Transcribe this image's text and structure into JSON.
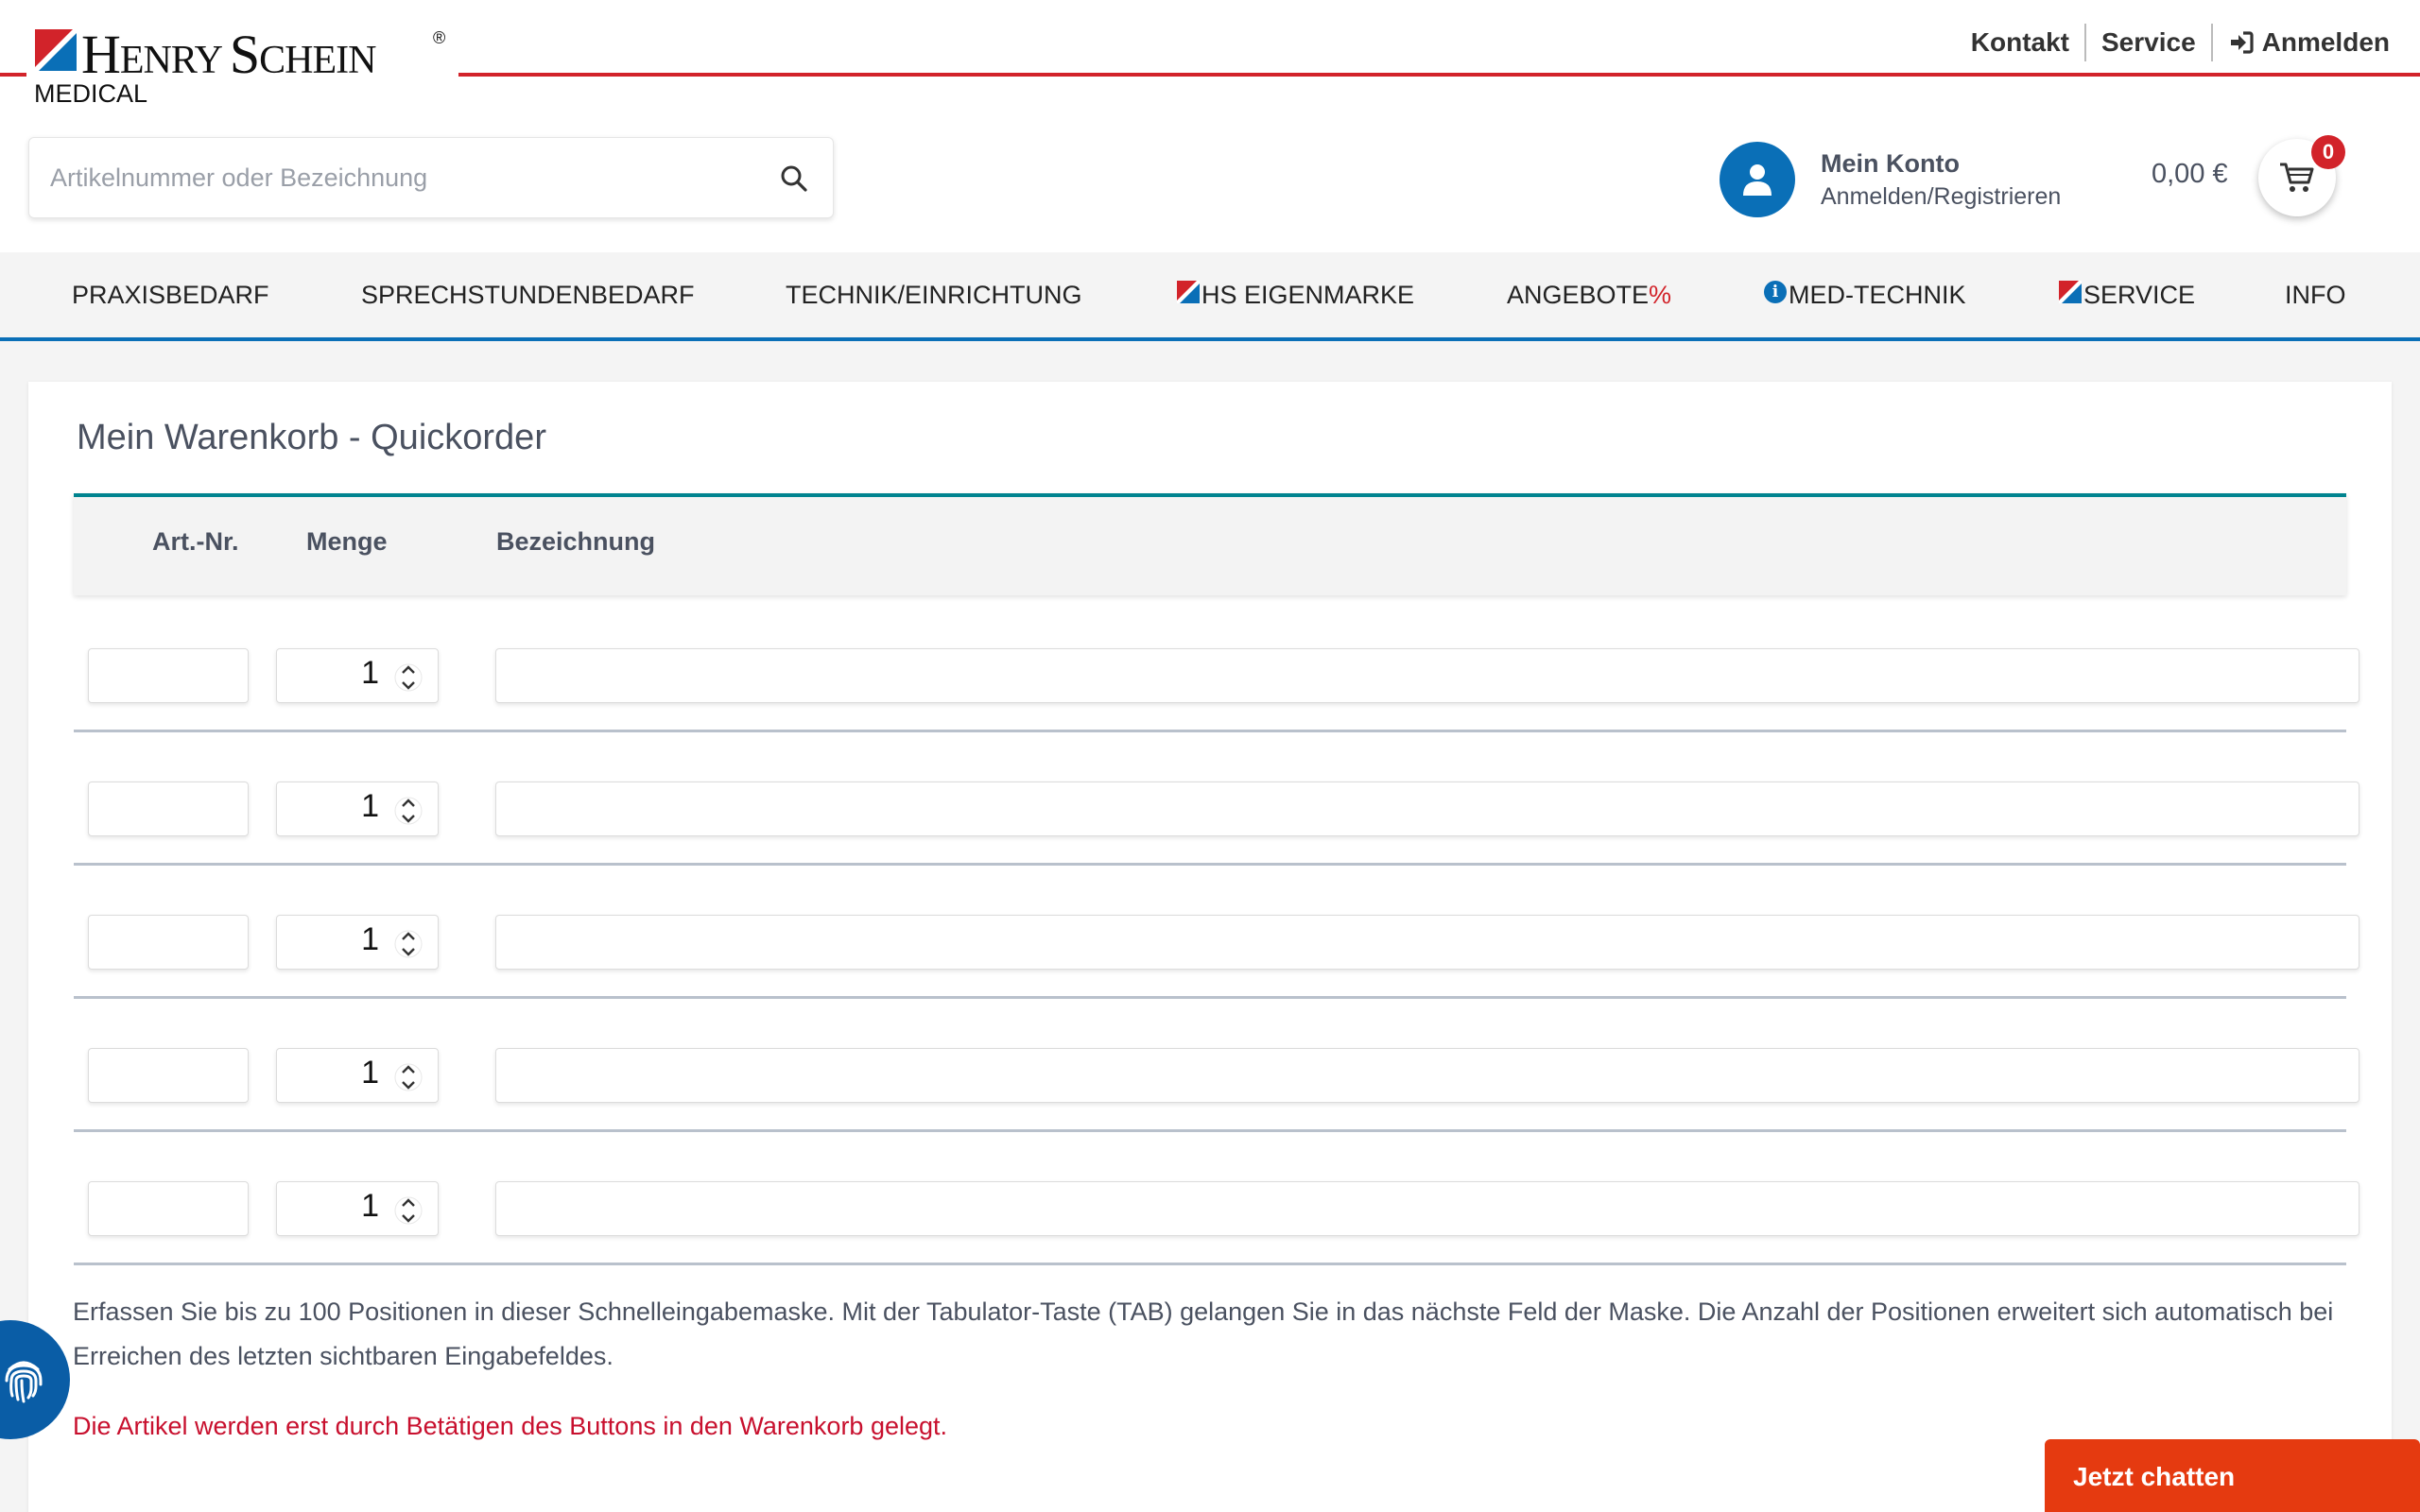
{
  "brand": {
    "name_first": "H",
    "name_first_small": "ENRY ",
    "name_second": "S",
    "name_second_small": "CHEIN",
    "registered": "®",
    "sub": "MEDICAL"
  },
  "toplinks": {
    "contact": "Kontakt",
    "service": "Service",
    "login": "Anmelden"
  },
  "search": {
    "placeholder": "Artikelnummer oder Bezeichnung"
  },
  "account": {
    "title": "Mein Konto",
    "subtitle": "Anmelden/Registrieren"
  },
  "cart": {
    "total": "0,00 €",
    "count": "0"
  },
  "nav": {
    "items": [
      {
        "label": "PRAXISBEDARF"
      },
      {
        "label": "SPRECHSTUNDENBEDARF"
      },
      {
        "label": "TECHNIK/EINRICHTUNG"
      },
      {
        "label": "HS EIGENMARKE"
      },
      {
        "label": "ANGEBOTE",
        "suffix": "%"
      },
      {
        "label": "MED-TECHNIK"
      },
      {
        "label": "SERVICE"
      },
      {
        "label": "INFO"
      }
    ]
  },
  "quickorder": {
    "title": "Mein Warenkorb - Quickorder",
    "columns": {
      "art": "Art.-Nr.",
      "qty": "Menge",
      "desc": "Bezeichnung"
    },
    "rows": [
      {
        "art": "",
        "qty": "1",
        "desc": ""
      },
      {
        "art": "",
        "qty": "1",
        "desc": ""
      },
      {
        "art": "",
        "qty": "1",
        "desc": ""
      },
      {
        "art": "",
        "qty": "1",
        "desc": ""
      },
      {
        "art": "",
        "qty": "1",
        "desc": ""
      }
    ],
    "info": "Erfassen Sie bis zu 100 Positionen in dieser Schnelleingabemaske. Mit der Tabulator-Taste (TAB) gelangen Sie in das nächste Feld der Maske. Die Anzahl der Positionen erweitert sich automatisch bei Erreichen des letzten sichtbaren Eingabefeldes.",
    "warning": "Die Artikel werden erst durch Betätigen des Buttons in den Warenkorb gelegt."
  },
  "chat": {
    "label": "Jetzt chatten"
  },
  "colors": {
    "brand_red": "#d2232a",
    "brand_blue": "#0a6fb7",
    "teal": "#00838f",
    "chat_orange": "#e53a10"
  }
}
